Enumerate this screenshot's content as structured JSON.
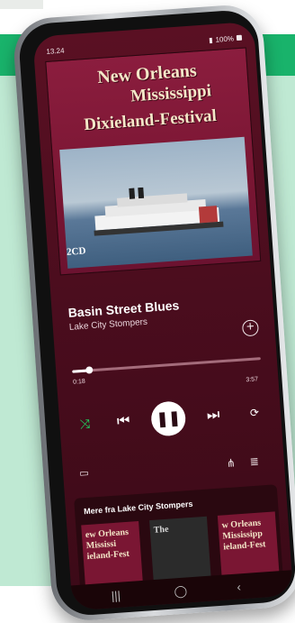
{
  "status_bar": {
    "time": "13.24",
    "right": "100%"
  },
  "album_art": {
    "line1": "New Orleans",
    "line2": "Mississippi",
    "line3": "Dixieland-Festival",
    "cd_label": "2CD"
  },
  "now_playing": {
    "title": "Basin Street Blues",
    "artist": "Lake City Stompers",
    "progress_fraction": 0.09,
    "time_elapsed": "0:18",
    "time_total": "3:57"
  },
  "controls": {
    "shuffle_active": true,
    "icons": [
      "shuffle-icon",
      "previous-icon",
      "pause-icon",
      "next-icon",
      "repeat-icon"
    ]
  },
  "actions": {
    "icons": [
      "devices-icon",
      "share-icon",
      "queue-icon"
    ]
  },
  "more_section": {
    "title": "Mere fra Lake City Stompers",
    "items": [
      {
        "line1": "ew Orleans",
        "line2": "Mississi",
        "line3": "ieland-Fest"
      },
      {
        "line1": "The",
        "line2": "",
        "line3": ""
      },
      {
        "line1": "w Orleans",
        "line2": "Mississipp",
        "line3": "ieland-Fest"
      }
    ]
  },
  "colors": {
    "accent_green": "#1ed760",
    "green_band": "#19b36b",
    "mint_panel": "#bfe9d3",
    "screen_background": "#4b0d1e"
  }
}
